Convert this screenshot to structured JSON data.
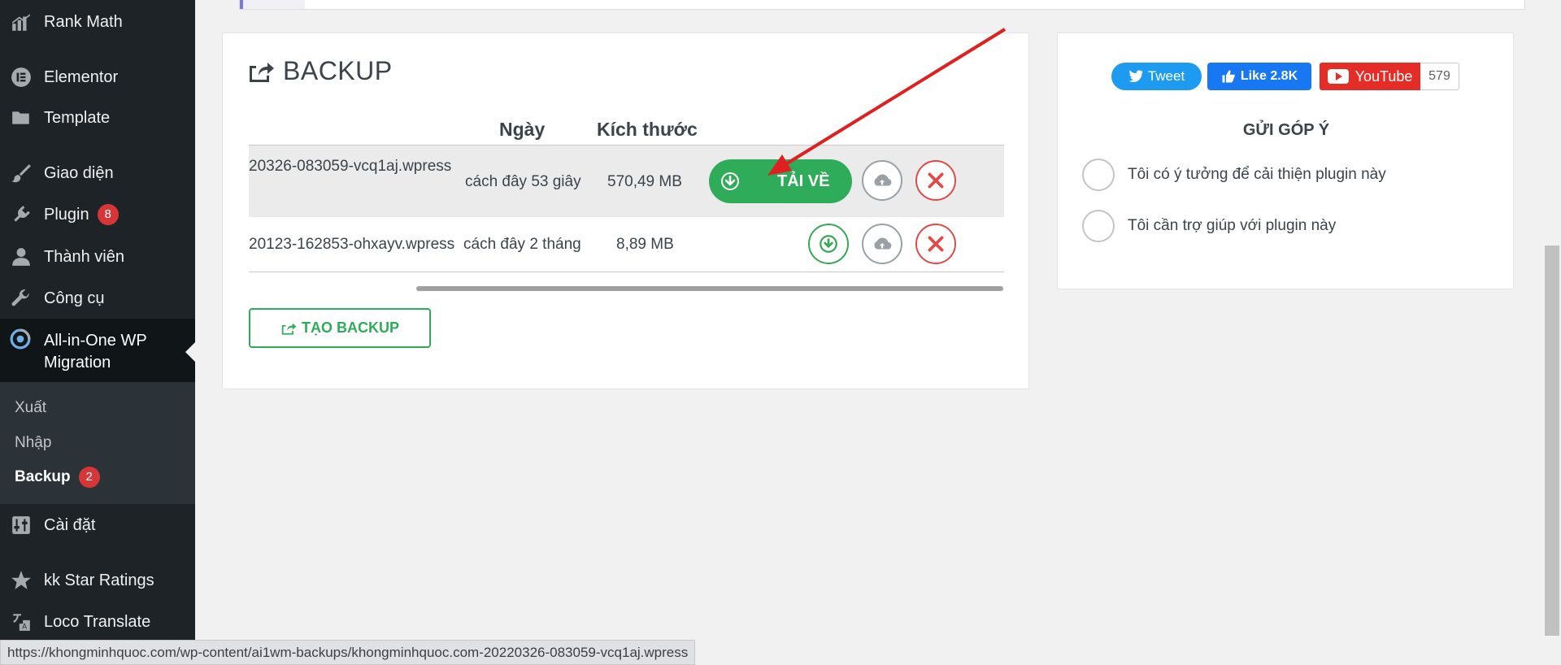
{
  "sidebar": {
    "items": [
      {
        "label": "Rank Math",
        "icon": "chart-bars-icon"
      },
      {
        "label": "Elementor",
        "icon": "elementor-icon"
      },
      {
        "label": "Template",
        "icon": "folder-icon"
      },
      {
        "label": "Giao diện",
        "icon": "brush-icon"
      },
      {
        "label": "Plugin",
        "icon": "plugin-icon",
        "badge": "8"
      },
      {
        "label": "Thành viên",
        "icon": "user-icon"
      },
      {
        "label": "Công cụ",
        "icon": "wrench-icon"
      },
      {
        "label_line1": "All-in-One WP",
        "label_line2": "Migration",
        "icon": "migration-icon"
      },
      {
        "label": "Cài đặt",
        "icon": "settings-icon"
      },
      {
        "label": "kk Star Ratings",
        "icon": "star-icon"
      },
      {
        "label": "Loco Translate",
        "icon": "translate-icon"
      }
    ],
    "submenu": [
      {
        "label": "Xuất"
      },
      {
        "label": "Nhập"
      },
      {
        "label": "Backup",
        "badge": "2"
      }
    ]
  },
  "backup": {
    "title": "BACKUP",
    "columns": {
      "date": "Ngày",
      "size": "Kích thước"
    },
    "rows": [
      {
        "file": "20326-083059-vcq1aj.wpress",
        "date": "cách đây 53 giây",
        "size": "570,49 MB"
      },
      {
        "file": "20123-162853-ohxayv.wpress",
        "date": "cách đây 2 tháng",
        "size": "8,89 MB"
      }
    ],
    "download_label": "TẢI VỀ",
    "create_label": "TẠO BACKUP"
  },
  "social": {
    "tweet": "Tweet",
    "like": "Like 2.8K",
    "youtube": "YouTube",
    "youtube_count": "579"
  },
  "feedback": {
    "title": "GỬI GÓP Ý",
    "options": [
      "Tôi có ý tưởng để cải thiện plugin này",
      "Tôi cần trợ giúp với plugin này"
    ]
  },
  "status_url": "https://khongminhquoc.com/wp-content/ai1wm-backups/khongminhquoc.com-20220326-083059-vcq1aj.wpress",
  "colors": {
    "accent_green": "#2eac5a",
    "danger_red": "#e04b46",
    "sidebar_bg": "#1d2327",
    "annotation_arrow": "#e02020"
  }
}
